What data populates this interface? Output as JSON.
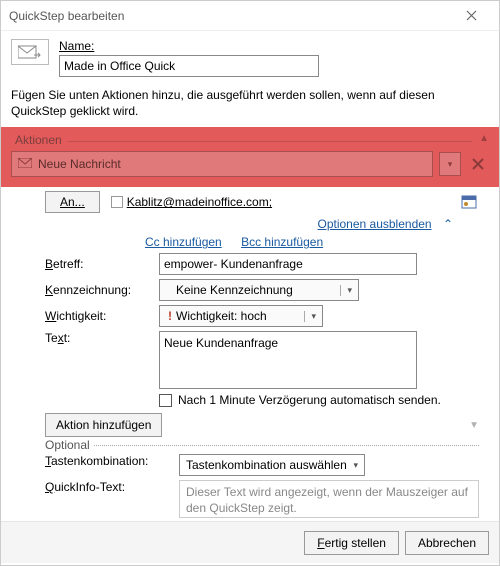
{
  "titlebar": {
    "title": "QuickStep bearbeiten"
  },
  "name": {
    "label": "Name:",
    "value": "Made in Office Quick"
  },
  "description": "Fügen Sie unten Aktionen hinzu, die ausgeführt werden sollen, wenn auf diesen QuickStep geklickt wird.",
  "actions": {
    "group_label": "Aktionen",
    "selected_action": "Neue Nachricht"
  },
  "message": {
    "to_button": "An...",
    "recipient": "Kablitz@madeinoffice.com;",
    "options_toggle": "Optionen ausblenden",
    "cc_link": "Cc hinzufügen",
    "bcc_link": "Bcc hinzufügen",
    "subject_label": "Betreff:",
    "subject_value": "empower- Kundenanfrage",
    "flag_label": "Kennzeichnung:",
    "flag_value": "Keine Kennzeichnung",
    "importance_label": "Wichtigkeit:",
    "importance_value": "Wichtigkeit: hoch",
    "text_label": "Text:",
    "text_value": "Neue Kundenanfrage",
    "delay_text": "Nach 1 Minute Verzögerung automatisch senden."
  },
  "add_action_button": "Aktion hinzufügen",
  "optional": {
    "group_label": "Optional",
    "hotkey_label": "Tastenkombination:",
    "hotkey_value": "Tastenkombination auswählen",
    "tooltip_label": "QuickInfo-Text:",
    "tooltip_placeholder": "Dieser Text wird angezeigt, wenn der Mauszeiger auf den QuickStep zeigt."
  },
  "footer": {
    "finish": "Fertig stellen",
    "cancel": "Abbrechen"
  }
}
